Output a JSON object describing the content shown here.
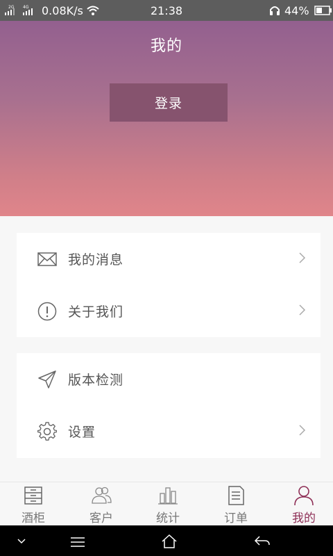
{
  "status_bar": {
    "sim1": "2G",
    "sim2": "4G",
    "net_speed": "0.08K/s",
    "time": "21:38",
    "battery": "44%"
  },
  "header": {
    "title": "我的",
    "login_label": "登录"
  },
  "menu_group_1": [
    {
      "label": "我的消息",
      "icon": "mail-icon",
      "chevron": true
    },
    {
      "label": "关于我们",
      "icon": "info-icon",
      "chevron": true
    }
  ],
  "menu_group_2": [
    {
      "label": "版本检测",
      "icon": "paper-plane-icon",
      "chevron": false
    },
    {
      "label": "设置",
      "icon": "gear-icon",
      "chevron": true
    }
  ],
  "tabs": [
    {
      "label": "酒柜",
      "icon": "cabinet-icon",
      "active": false
    },
    {
      "label": "客户",
      "icon": "customers-icon",
      "active": false
    },
    {
      "label": "统计",
      "icon": "stats-icon",
      "active": false
    },
    {
      "label": "订单",
      "icon": "order-icon",
      "active": false
    },
    {
      "label": "我的",
      "icon": "user-icon",
      "active": true
    }
  ],
  "colors": {
    "header_top": "#93608f",
    "header_bottom": "#e0858a",
    "login_button": "#86536e",
    "active_tab": "#8e2f56"
  }
}
